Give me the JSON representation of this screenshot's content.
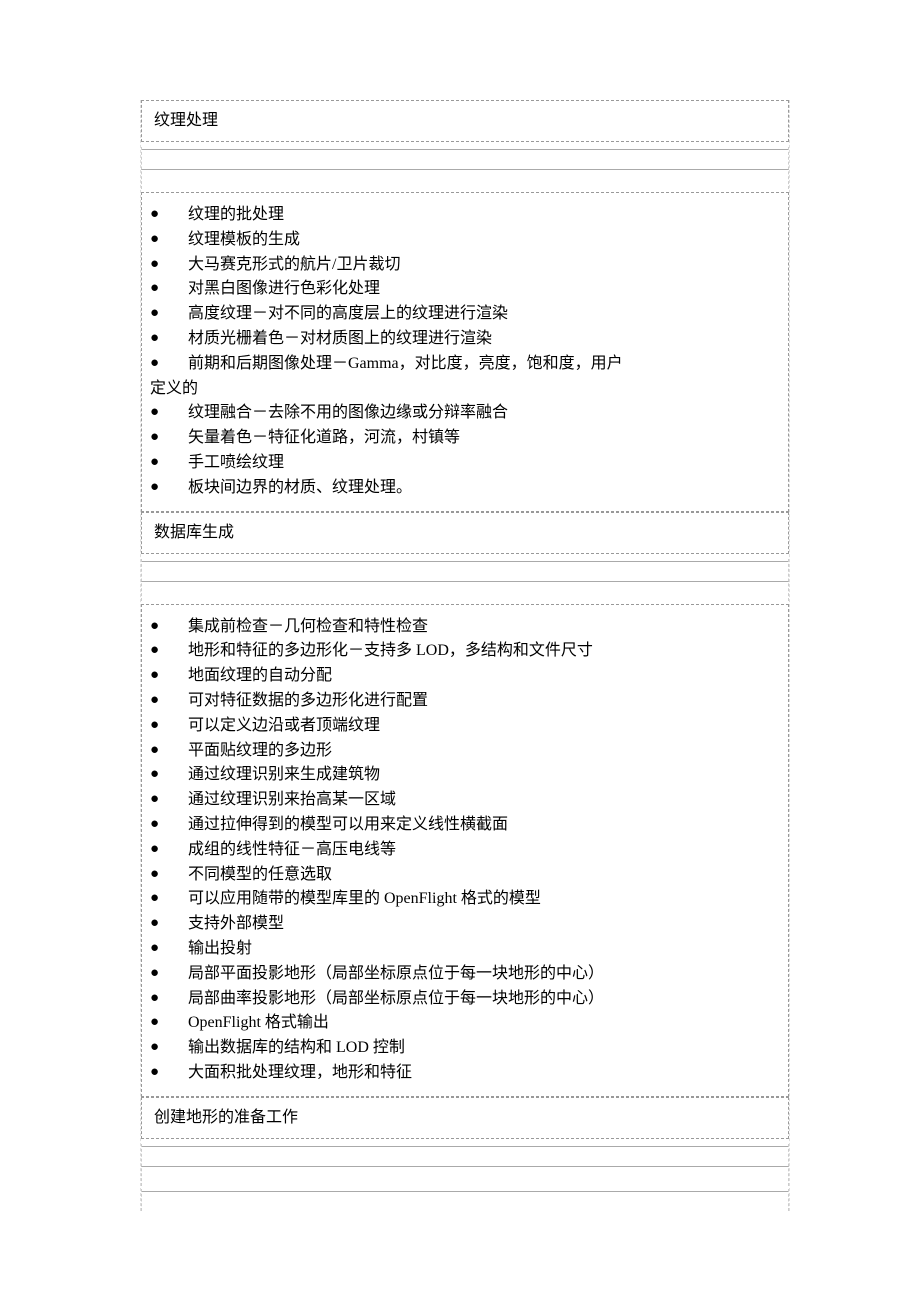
{
  "sections": [
    {
      "header": "纹理处理",
      "items": [
        "纹理的批处理",
        "纹理模板的生成",
        "大马赛克形式的航片/卫片裁切",
        "对黑白图像进行色彩化处理",
        "高度纹理－对不同的高度层上的纹理进行渲染",
        "材质光栅着色－对材质图上的纹理进行渲染",
        "前期和后期图像处理－Gamma，对比度，亮度，饱和度，用户"
      ],
      "continuation": "定义的",
      "items_after": [
        "纹理融合－去除不用的图像边缘或分辩率融合",
        "矢量着色－特征化道路，河流，村镇等",
        "手工喷绘纹理",
        "板块间边界的材质、纹理处理。"
      ]
    },
    {
      "header": "数据库生成",
      "items": [
        "集成前检查－几何检查和特性检查",
        "地形和特征的多边形化－支持多 LOD，多结构和文件尺寸",
        "地面纹理的自动分配",
        "可对特征数据的多边形化进行配置",
        "可以定义边沿或者顶端纹理",
        "平面贴纹理的多边形",
        "通过纹理识别来生成建筑物",
        "通过纹理识别来抬高某一区域",
        "通过拉伸得到的模型可以用来定义线性横截面",
        "成组的线性特征－高压电线等",
        "不同模型的任意选取",
        "可以应用随带的模型库里的 OpenFlight 格式的模型",
        "支持外部模型",
        "输出投射",
        "局部平面投影地形（局部坐标原点位于每一块地形的中心）",
        "局部曲率投影地形（局部坐标原点位于每一块地形的中心）",
        "OpenFlight 格式输出",
        "输出数据库的结构和  LOD  控制",
        "大面积批处理纹理，地形和特征"
      ]
    },
    {
      "header": "创建地形的准备工作",
      "items": []
    }
  ],
  "bullet_char": "●"
}
